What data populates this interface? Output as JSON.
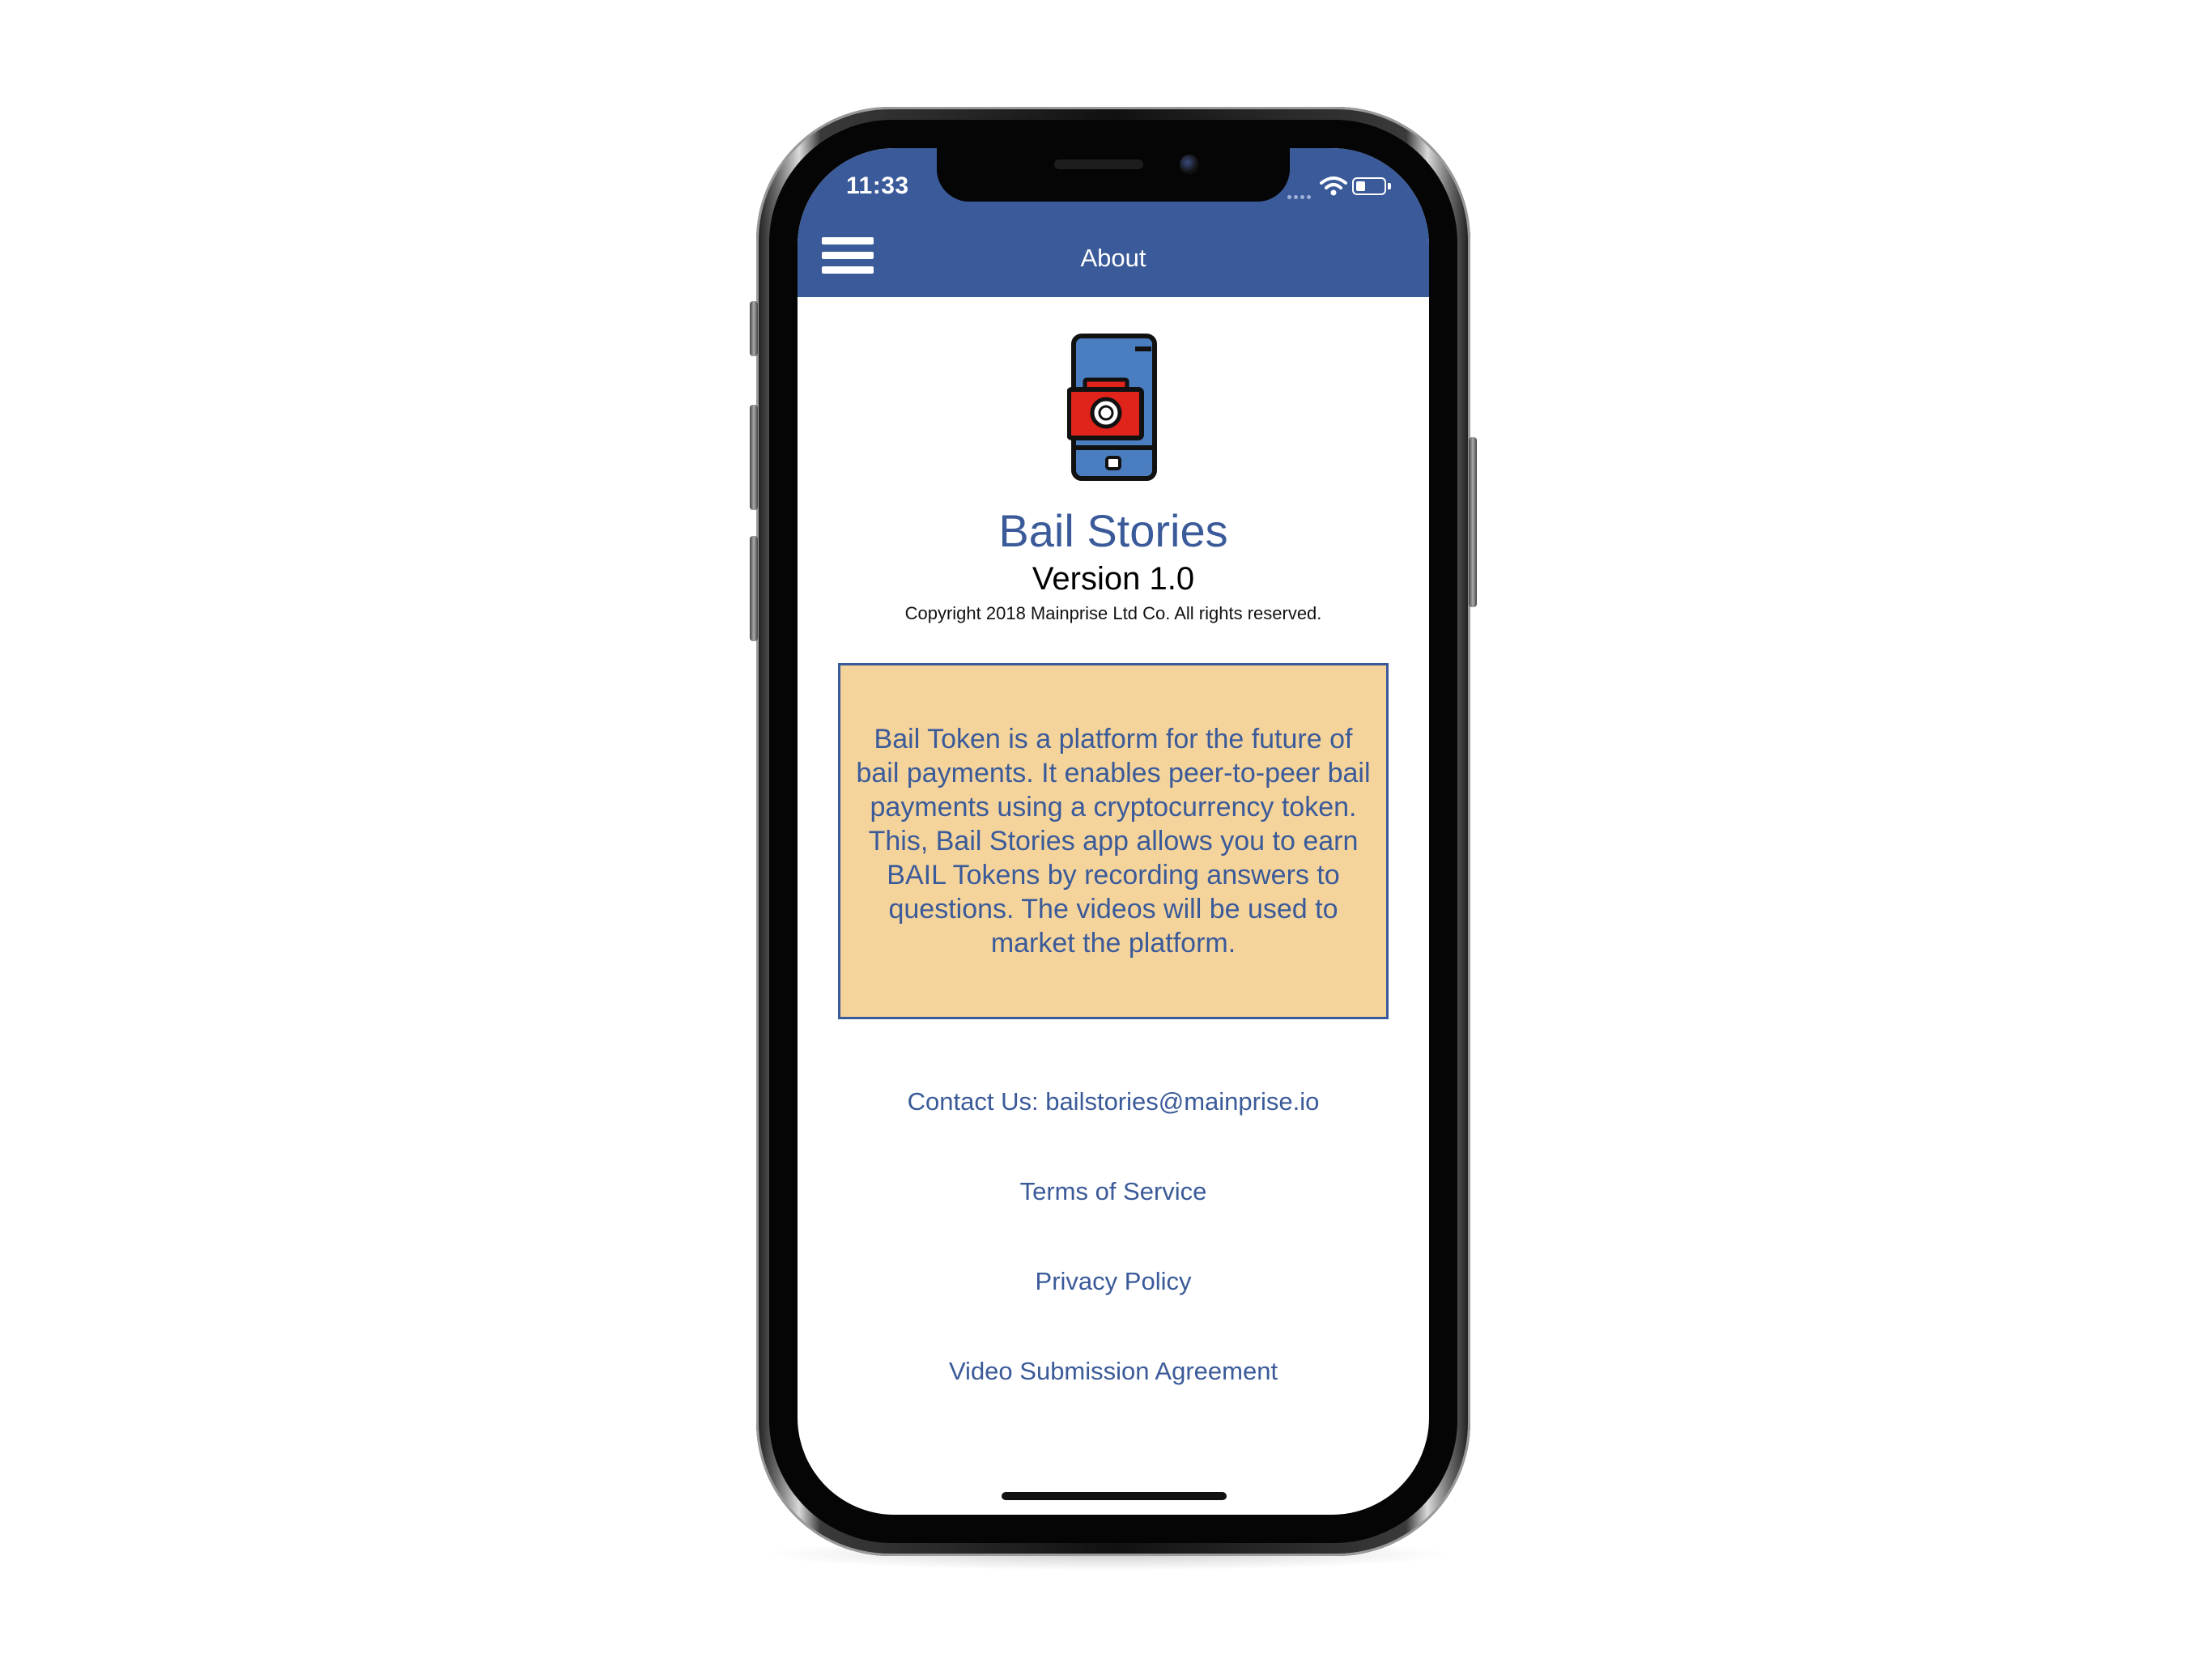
{
  "status_bar": {
    "time": "11:33"
  },
  "header": {
    "title": "About",
    "menu_icon": "hamburger-menu-icon"
  },
  "app": {
    "icon": "phone-camera-icon",
    "name": "Bail Stories",
    "version": "Version 1.0",
    "copyright": "Copyright 2018 Mainprise Ltd Co. All rights reserved."
  },
  "description": "Bail Token is a platform for the future of bail payments. It enables peer-to-peer bail payments using a cryptocurrency token. This, Bail Stories app allows you to earn BAIL Tokens by recording answers to questions. The videos will be used to market the platform.",
  "links": {
    "contact": "Contact Us: bailstories@mainprise.io",
    "terms": "Terms of Service",
    "privacy": "Privacy Policy",
    "video_agreement": "Video Submission Agreement"
  },
  "colors": {
    "accent": "#3a5a99",
    "description_background": "#f5d49c",
    "camera_red": "#e0241b"
  }
}
